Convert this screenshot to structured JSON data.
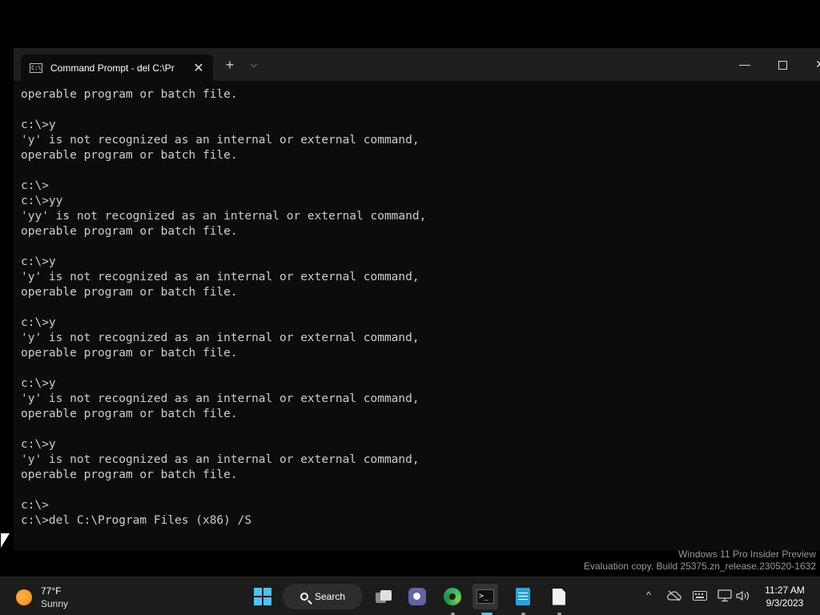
{
  "window": {
    "tab_title": "Command Prompt - del  C:\\Pr",
    "tab_icon_text": "C:\\",
    "tab_close": "✕",
    "new_tab": "+",
    "dropdown": "⌵",
    "minimize": "—",
    "close": "✕"
  },
  "console": {
    "lines": [
      "operable program or batch file.",
      "",
      "c:\\>y",
      "'y' is not recognized as an internal or external command,",
      "operable program or batch file.",
      "",
      "c:\\>",
      "c:\\>yy",
      "'yy' is not recognized as an internal or external command,",
      "operable program or batch file.",
      "",
      "c:\\>y",
      "'y' is not recognized as an internal or external command,",
      "operable program or batch file.",
      "",
      "c:\\>y",
      "'y' is not recognized as an internal or external command,",
      "operable program or batch file.",
      "",
      "c:\\>y",
      "'y' is not recognized as an internal or external command,",
      "operable program or batch file.",
      "",
      "c:\\>y",
      "'y' is not recognized as an internal or external command,",
      "operable program or batch file.",
      "",
      "c:\\>",
      "c:\\>del C:\\Program Files (x86) /S"
    ]
  },
  "watermark": {
    "line1": "Windows 11 Pro Insider Preview",
    "line2": "Evaluation copy. Build 25375.zn_release.230520-1632"
  },
  "taskbar": {
    "weather_temp": "77°F",
    "weather_condition": "Sunny",
    "search_label": "Search",
    "tray_chevron": "^",
    "time": "11:27 AM",
    "date": "9/3/2023"
  },
  "colors": {
    "accent": "#4cc2ff",
    "console_bg": "#0c0c0c",
    "console_fg": "#cccccc"
  }
}
